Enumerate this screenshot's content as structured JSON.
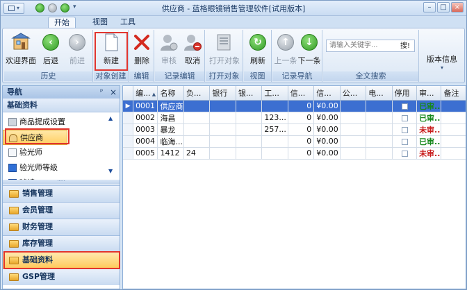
{
  "window": {
    "title": "供应商 - 蓝格眼镜销售管理软件[试用版本]"
  },
  "menu_tabs": [
    "开始",
    "视图",
    "工具"
  ],
  "ribbon": {
    "buttons": {
      "home": "欢迎界面",
      "back": "后退",
      "forward": "前进",
      "new": "新建",
      "delete": "删除",
      "audit": "审核",
      "cancel": "取消",
      "open_object": "打开对象",
      "refresh": "刷新",
      "prev": "上一条",
      "next": "下一条",
      "version": "版本信息"
    },
    "groups": {
      "history": "历史",
      "object_create": "对象创建",
      "edit": "编辑",
      "record_edit": "记录编辑",
      "open_object": "打开对象",
      "view": "视图",
      "record_nav": "记录导航",
      "fulltext": "全文搜索"
    },
    "search": {
      "placeholder": "请输入关键字...",
      "button": "搜!"
    }
  },
  "nav": {
    "title": "导航",
    "pin": "ᵖ",
    "close": "×",
    "section": "基础资料",
    "items": [
      "商品提成设置",
      "供应商",
      "验光师",
      "验光师等级",
      "球镜"
    ],
    "selected_item": "供应商",
    "groups": [
      "销售管理",
      "会员管理",
      "财务管理",
      "库存管理",
      "基础资料",
      "GSP管理"
    ],
    "selected_group": "基础资料"
  },
  "grid": {
    "columns": [
      "编...",
      "名称",
      "负...",
      "银行",
      "银...",
      "工...",
      "信...",
      "信...",
      "公...",
      "电...",
      "停用",
      "审...",
      "备注"
    ],
    "rows": [
      [
        "0001",
        "供应商",
        "",
        "",
        "",
        "",
        "0",
        "¥0.00",
        "",
        "",
        "",
        "已审...",
        ""
      ],
      [
        "0002",
        "海昌",
        "",
        "",
        "",
        "123...",
        "0",
        "¥0.00",
        "",
        "",
        "",
        "已审...",
        ""
      ],
      [
        "0003",
        "暴龙",
        "",
        "",
        "",
        "257...",
        "0",
        "¥0.00",
        "",
        "",
        "",
        "未审...",
        ""
      ],
      [
        "0004",
        "临海...",
        "",
        "",
        "",
        "",
        "0",
        "¥0.00",
        "",
        "",
        "",
        "已审...",
        ""
      ],
      [
        "0005",
        "1412",
        "24",
        "",
        "",
        "",
        "0",
        "¥0.00",
        "",
        "",
        "",
        "未审...",
        ""
      ]
    ],
    "status_colors": {
      "approved": "#16871c",
      "pending": "#c81d1d"
    }
  }
}
